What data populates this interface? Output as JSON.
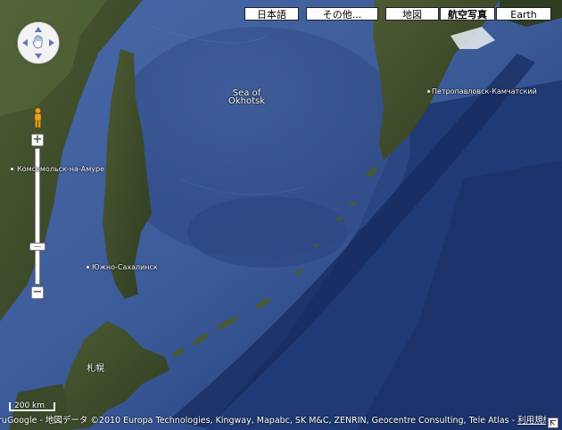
{
  "map_types": [
    {
      "label": "日本語",
      "active": false
    },
    {
      "label": "その他...",
      "active": false
    },
    {
      "label": "地図",
      "active": false
    },
    {
      "label": "航空写真",
      "active": true
    },
    {
      "label": "Earth",
      "active": false
    }
  ],
  "place_labels": {
    "sea_of_okhotsk": [
      "Sea of",
      "Okhotsk"
    ],
    "petropavlovsk": "Петропавловск-Камчатский",
    "komsomolsk": "Комсомольск-на-Амуре",
    "yuzhno": "Южно-Сахалинск",
    "sapporo": "札幌"
  },
  "scale": {
    "label": "200 km"
  },
  "attribution": {
    "prefix": "ru",
    "text": "Google - 地図データ ©2010 Europa Technologies, Kingway, Mapabc, SK M&C, ZENRIN, Geocentre Consulting, Tele Atlas -",
    "terms": "利用規約"
  },
  "colors": {
    "ocean_deep": "#1e3a78",
    "ocean_mid": "#2e4a86",
    "land": "#3a4a2a",
    "snow": "#e8eef0"
  },
  "icons": {
    "pan": "hand-pan-icon",
    "streetview": "pegman-icon",
    "zoom_in": "+",
    "zoom_out": "−"
  }
}
